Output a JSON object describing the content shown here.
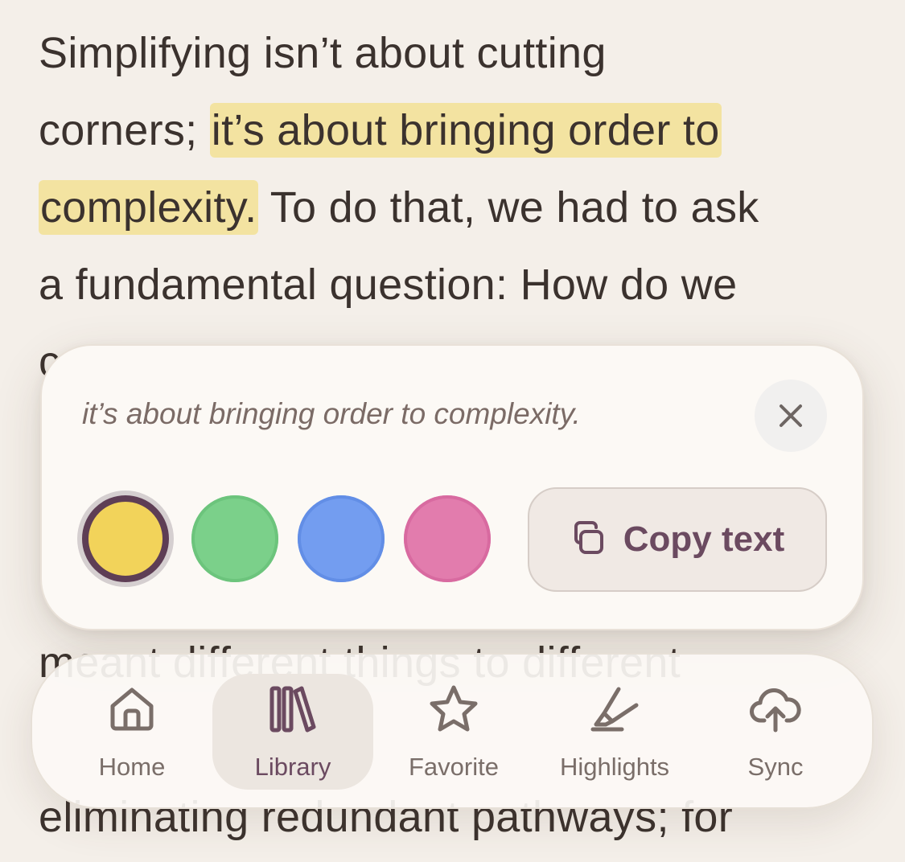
{
  "reader": {
    "lines": [
      "Simplifying isn’t about cutting",
      "corners;",
      "it’s about bringing order to",
      "complexity.",
      "To do that, we had to ask",
      "a fundamental question: How do we",
      "meant different things to different",
      "eliminating redundant pathways; for"
    ],
    "partial_line_char": "c"
  },
  "popover": {
    "quote": "it’s about bringing order to complexity.",
    "close_icon": "close-icon",
    "colors": [
      {
        "name": "yellow",
        "fill": "#f2d35a",
        "selected": true
      },
      {
        "name": "green",
        "fill": "#7bd08a",
        "selected": false
      },
      {
        "name": "blue",
        "fill": "#739df0",
        "selected": false
      },
      {
        "name": "pink",
        "fill": "#e27cad",
        "selected": false
      }
    ],
    "copy_label": "Copy text",
    "copy_icon": "copy-icon"
  },
  "nav": {
    "items": [
      {
        "label": "Home",
        "icon": "home-icon",
        "active": false
      },
      {
        "label": "Library",
        "icon": "library-icon",
        "active": true
      },
      {
        "label": "Favorite",
        "icon": "star-icon",
        "active": false
      },
      {
        "label": "Highlights",
        "icon": "highlighter-icon",
        "active": false
      },
      {
        "label": "Sync",
        "icon": "cloud-upload-icon",
        "active": false
      }
    ]
  },
  "colors": {
    "background": "#f4efe9",
    "highlight": "#f3e3a1",
    "accent": "#6b4a60",
    "text": "#3b322e"
  }
}
